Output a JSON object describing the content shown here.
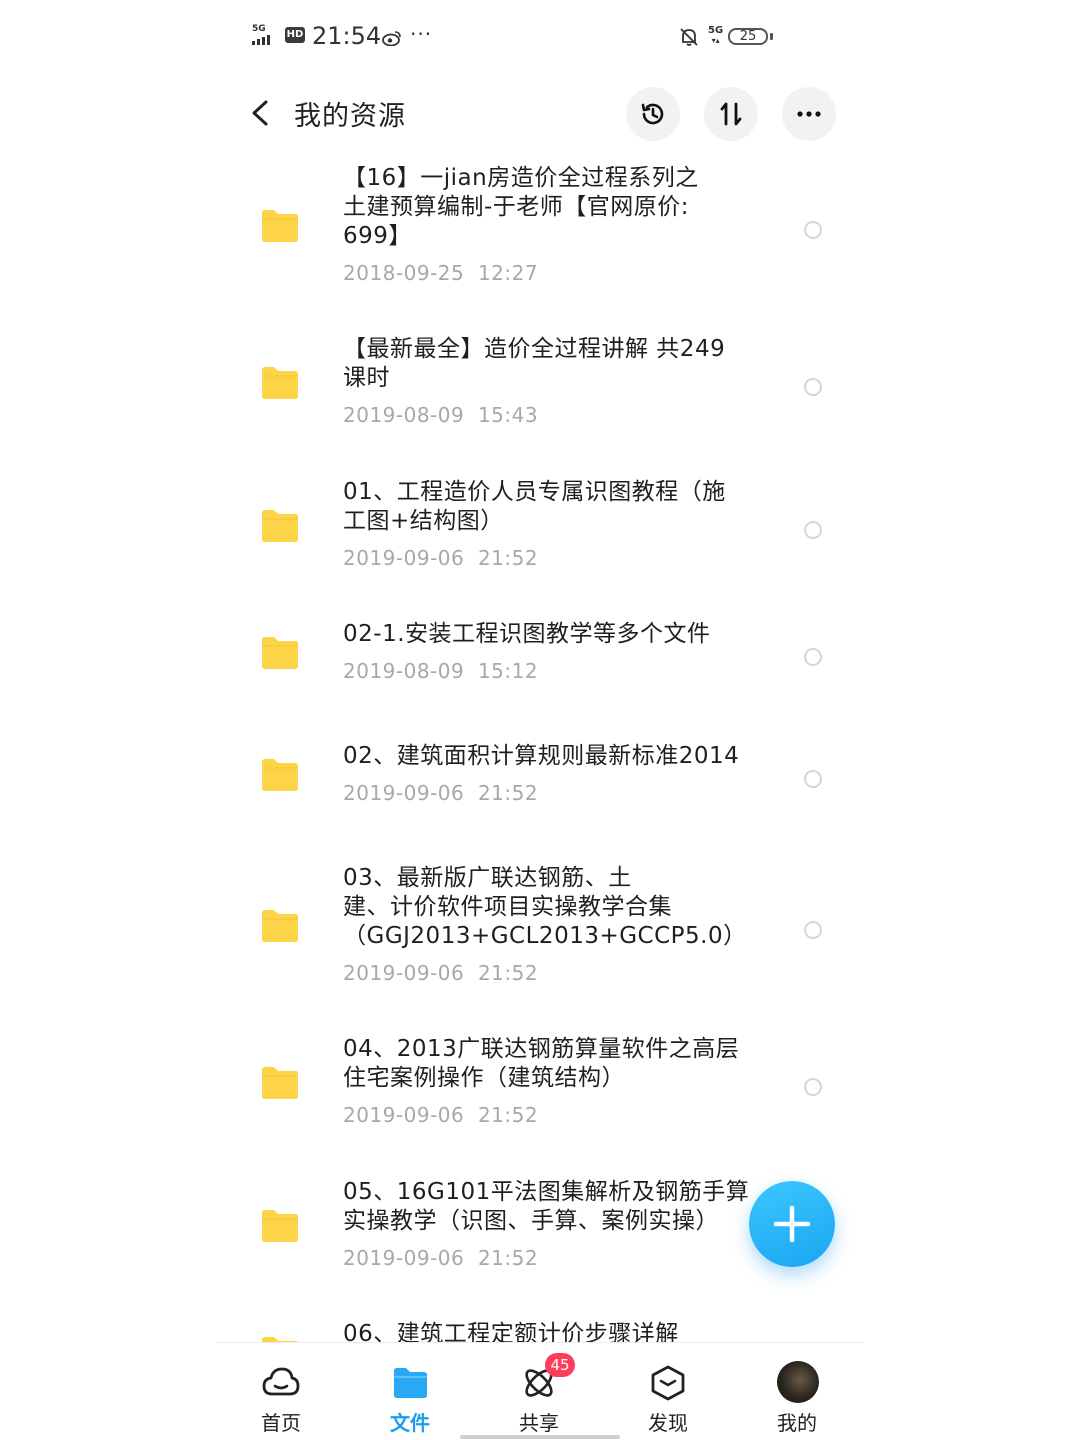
{
  "status_bar": {
    "network_left": "5G",
    "hd": "HD",
    "time": "21:54",
    "dots": "···",
    "network_right": "5G",
    "battery": "25"
  },
  "header": {
    "title": "我的资源",
    "buttons": [
      "history-icon",
      "sort-icon",
      "more-icon"
    ]
  },
  "files": [
    {
      "title": "【16】一jian房造价全过程系列之\n土建预算编制-于老师【官网原价:\n699】",
      "date": "2018-09-25  12:27"
    },
    {
      "title": "【最新最全】造价全过程讲解 共249\n课时",
      "date": "2019-08-09  15:43"
    },
    {
      "title": "01、工程造价人员专属识图教程（施\n工图+结构图）",
      "date": "2019-09-06  21:52"
    },
    {
      "title": "02-1.安装工程识图教学等多个文件",
      "date": "2019-08-09  15:12"
    },
    {
      "title": "02、建筑面积计算规则最新标准2014",
      "date": "2019-09-06  21:52"
    },
    {
      "title": "03、最新版广联达钢筋、土\n建、计价软件项目实操教学合集\n（GGJ2013+GCL2013+GCCP5.0）",
      "date": "2019-09-06  21:52"
    },
    {
      "title": "04、2013广联达钢筋算量软件之高层\n住宅案例操作（建筑结构）",
      "date": "2019-09-06  21:52"
    },
    {
      "title": "05、16G101平法图集解析及钢筋手算\n实操教学（识图、手算、案例实操）",
      "date": "2019-09-06  21:52"
    },
    {
      "title": "06、建筑工程定额计价步骤详解",
      "date": ""
    }
  ],
  "fab": {
    "icon": "plus-icon"
  },
  "bottom_nav": [
    {
      "label": "首页",
      "icon": "cloud-icon"
    },
    {
      "label": "文件",
      "icon": "folder-icon",
      "active": true
    },
    {
      "label": "共享",
      "icon": "share-icon",
      "badge": "45"
    },
    {
      "label": "发现",
      "icon": "cube-icon"
    },
    {
      "label": "我的",
      "icon": "avatar"
    }
  ],
  "colors": {
    "accent": "#1a9cf0",
    "folder": "#fdd447",
    "date_text": "#a8a8a8",
    "badge": "#ff3d5a"
  }
}
